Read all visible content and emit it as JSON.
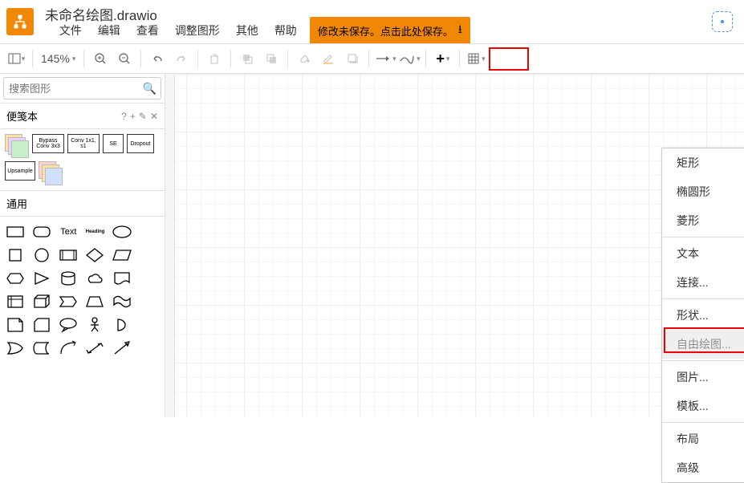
{
  "header": {
    "title": "未命名绘图.drawio",
    "menus": [
      "文件",
      "编辑",
      "查看",
      "调整图形",
      "其他",
      "帮助"
    ],
    "save_notice": "修改未保存。点击此处保存。"
  },
  "toolbar": {
    "zoom": "145%"
  },
  "sidebar": {
    "search_placeholder": "搜索图形",
    "scratchpad_title": "便笺本",
    "scratch_labels": [
      "",
      "Bypass Conv 3x3",
      "Conv 1x1, s1",
      "SE",
      "Dropout",
      "Upsample",
      ""
    ],
    "general_title": "通用",
    "shape_text_label": "Text",
    "shape_heading_label": "Heading"
  },
  "dropdown": {
    "items": [
      {
        "label": "矩形",
        "type": "item"
      },
      {
        "label": "椭圆形",
        "type": "item"
      },
      {
        "label": "菱形",
        "type": "item"
      },
      {
        "type": "sep"
      },
      {
        "label": "文本",
        "type": "item"
      },
      {
        "label": "连接...",
        "type": "item"
      },
      {
        "type": "sep"
      },
      {
        "label": "形状...",
        "type": "item"
      },
      {
        "label": "自由绘图...",
        "type": "item",
        "highlight": true
      },
      {
        "type": "sep"
      },
      {
        "label": "图片...",
        "type": "item"
      },
      {
        "label": "模板...",
        "type": "item"
      },
      {
        "type": "sep"
      },
      {
        "label": "布局",
        "type": "sub"
      },
      {
        "label": "高级",
        "type": "sub"
      }
    ]
  }
}
